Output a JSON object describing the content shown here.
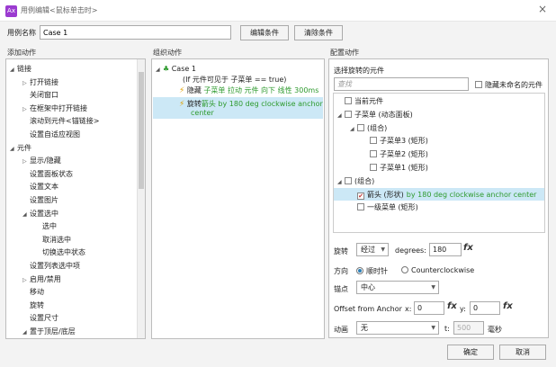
{
  "window": {
    "logo": "Ax",
    "title": "用例编辑<鼠标单击时>",
    "close_icon": "×"
  },
  "usecase": {
    "label": "用例名称",
    "value": "Case 1",
    "edit_btn": "编辑条件",
    "clear_btn": "清除条件"
  },
  "sections": {
    "add": "添加动作",
    "organize": "组织动作",
    "config": "配置动作"
  },
  "left_tree": [
    {
      "label": "链接",
      "level": 0,
      "expand": "open"
    },
    {
      "label": "打开链接",
      "level": 1,
      "expand": "closed"
    },
    {
      "label": "关闭窗口",
      "level": 1,
      "expand": "none"
    },
    {
      "label": "在框架中打开链接",
      "level": 1,
      "expand": "closed"
    },
    {
      "label": "滚动到元件<锚链接>",
      "level": 1,
      "expand": "none"
    },
    {
      "label": "设置自适应视图",
      "level": 1,
      "expand": "none"
    },
    {
      "label": "元件",
      "level": 0,
      "expand": "open"
    },
    {
      "label": "显示/隐藏",
      "level": 1,
      "expand": "closed"
    },
    {
      "label": "设置面板状态",
      "level": 1,
      "expand": "none"
    },
    {
      "label": "设置文本",
      "level": 1,
      "expand": "none"
    },
    {
      "label": "设置图片",
      "level": 1,
      "expand": "none"
    },
    {
      "label": "设置选中",
      "level": 1,
      "expand": "open"
    },
    {
      "label": "选中",
      "level": 2,
      "expand": "none"
    },
    {
      "label": "取消选中",
      "level": 2,
      "expand": "none"
    },
    {
      "label": "切换选中状态",
      "level": 2,
      "expand": "none"
    },
    {
      "label": "设置列表选中项",
      "level": 1,
      "expand": "none"
    },
    {
      "label": "启用/禁用",
      "level": 1,
      "expand": "closed"
    },
    {
      "label": "移动",
      "level": 1,
      "expand": "none"
    },
    {
      "label": "旋转",
      "level": 1,
      "expand": "none"
    },
    {
      "label": "设置尺寸",
      "level": 1,
      "expand": "none"
    },
    {
      "label": "置于顶层/底层",
      "level": 1,
      "expand": "open"
    }
  ],
  "organize": {
    "case_title": "Case 1",
    "condition": "(If 元件可见于 子菜单 == true)",
    "action1_prefix": "隐藏",
    "action1_detail": "子菜单 拉动 元件 向下 线性 300ms",
    "action2_prefix": "旋转",
    "action2_detail_line1": "箭头 by 180 deg clockwise anchor",
    "action2_detail_line2": "center"
  },
  "config": {
    "select_label": "选择旋转的元件",
    "search_placeholder": "查找",
    "hide_unnamed": "隐藏未命名的元件",
    "tree": [
      {
        "label": "当前元件",
        "level": 0,
        "expand": "none",
        "checked": false,
        "extra": "",
        "selected": false
      },
      {
        "label": "子菜单 (动态面板)",
        "level": 0,
        "expand": "open",
        "checked": false,
        "extra": "",
        "selected": false
      },
      {
        "label": "(组合)",
        "level": 1,
        "expand": "open",
        "checked": false,
        "extra": "",
        "selected": false
      },
      {
        "label": "子菜单3 (矩形)",
        "level": 2,
        "expand": "none",
        "checked": false,
        "extra": "",
        "selected": false
      },
      {
        "label": "子菜单2 (矩形)",
        "level": 2,
        "expand": "none",
        "checked": false,
        "extra": "",
        "selected": false
      },
      {
        "label": "子菜单1 (矩形)",
        "level": 2,
        "expand": "none",
        "checked": false,
        "extra": "",
        "selected": false
      },
      {
        "label": "(组合)",
        "level": 0,
        "expand": "open",
        "checked": false,
        "extra": "",
        "selected": false
      },
      {
        "label": "箭头 (形状)",
        "level": 1,
        "expand": "none",
        "checked": true,
        "extra": "by 180 deg clockwise anchor center",
        "selected": true
      },
      {
        "label": "一级菜单 (矩形)",
        "level": 1,
        "expand": "none",
        "checked": false,
        "extra": "",
        "selected": false
      }
    ],
    "rotate_label": "旋转",
    "rotate_mode": "经过",
    "degrees_label": "degrees:",
    "degrees_value": "180",
    "fx": "fx",
    "direction_label": "方向",
    "clockwise": "顺时针",
    "counterclockwise": "Counterclockwise",
    "anchor_label": "锚点",
    "anchor_value": "中心",
    "offset_label": "Offset from Anchor",
    "x_label": "x:",
    "x_value": "0",
    "y_label": "y:",
    "y_value": "0",
    "anim_label": "动画",
    "anim_value": "无",
    "t_label": "t:",
    "t_value": "500",
    "ms_label": "毫秒"
  },
  "footer": {
    "ok": "确定",
    "cancel": "取消"
  }
}
